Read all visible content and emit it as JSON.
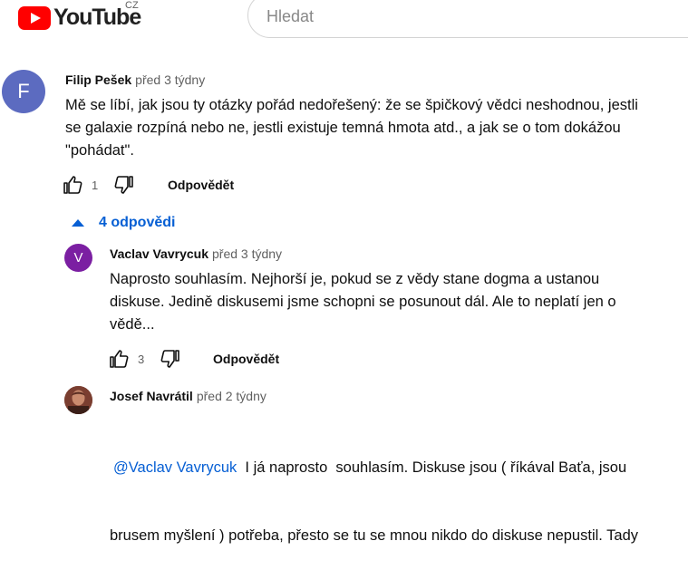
{
  "header": {
    "logo_text": "YouTube",
    "country_code": "CZ",
    "search_placeholder": "Hledat"
  },
  "comment": {
    "avatar_letter": "F",
    "avatar_color": "#5c6bc0",
    "author": "Filip Pešek",
    "time": "před 3 týdny",
    "text_lines": [
      "Mě se líbí, jak jsou ty otázky pořád nedořešený: že se špičkový vědci neshodnou, jestli",
      "se galaxie rozpíná nebo ne, jestli existuje temná hmota atd., a jak se o tom dokážou",
      "\"pohádat\"."
    ],
    "likes": "1",
    "reply_label": "Odpovědět"
  },
  "replies_toggle": {
    "label": "4 odpovědi",
    "color": "#065fd4"
  },
  "replies": [
    {
      "avatar_letter": "V",
      "avatar_color": "#7b1fa2",
      "author": "Vaclav Vavrycuk",
      "time": "před 3 týdny",
      "text_lines": [
        "Naprosto souhlasím. Nejhorší je, pokud se z vědy stane dogma a ustanou",
        "diskuse. Jedině diskusemi jsme schopni se posunout dál. Ale to neplatí jen o",
        "vědě..."
      ],
      "likes": "3",
      "reply_label": "Odpovědět"
    },
    {
      "avatar_letter": "",
      "avatar_color": "#8d4a3a",
      "author": "Josef Navrátil",
      "time": "před 2 týdny",
      "mention": "@Vaclav Vavrycuk",
      "text_lines": [
        "  I já naprosto  souhlasím. Diskuse jsou ( říkával Baťa, jsou",
        "brusem myšlení ) potřeba, přesto se tu se mnou nikdo do diskuse nepustil. Tady"
      ]
    }
  ]
}
